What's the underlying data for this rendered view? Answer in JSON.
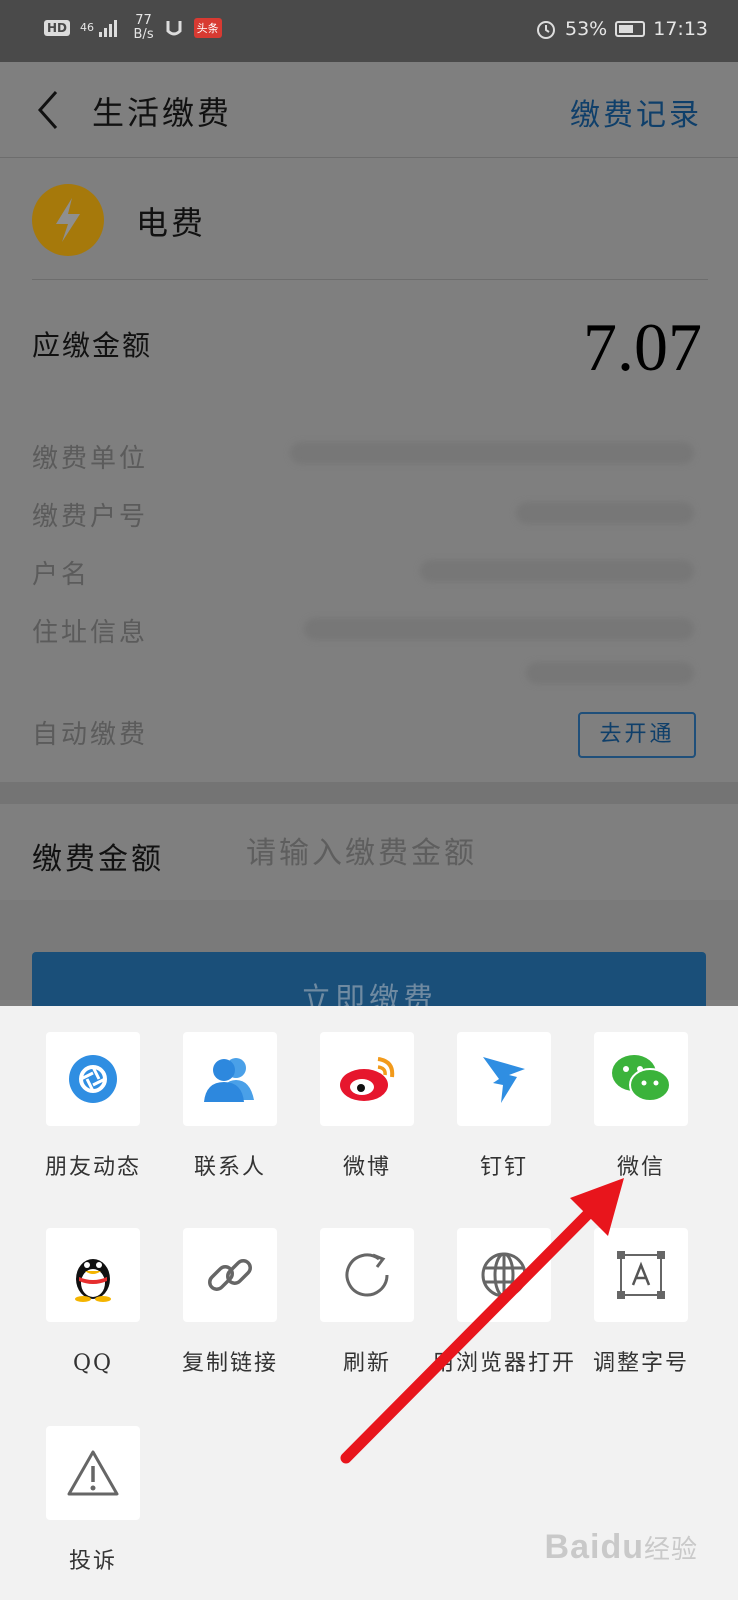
{
  "status_bar": {
    "hd": "HD",
    "network": "46",
    "speed_value": "77",
    "speed_unit": "B/s",
    "app_badge": "头条",
    "battery": "53%",
    "time": "17:13"
  },
  "nav": {
    "title": "生活缴费",
    "records_link": "缴费记录"
  },
  "bill": {
    "type": "电费",
    "due_label": "应缴金额",
    "due_amount": "7.07",
    "fields": [
      "缴费单位",
      "缴费户号",
      "户名",
      "住址信息",
      "自动缴费"
    ],
    "auto_pay_button": "去开通"
  },
  "payment": {
    "amount_label": "缴费金额",
    "amount_placeholder": "请输入缴费金额",
    "pay_button": "立即缴费"
  },
  "share_sheet": {
    "items": [
      {
        "label": "朋友动态",
        "icon": "friends-moments-icon"
      },
      {
        "label": "联系人",
        "icon": "contacts-icon"
      },
      {
        "label": "微博",
        "icon": "weibo-icon"
      },
      {
        "label": "钉钉",
        "icon": "dingtalk-icon"
      },
      {
        "label": "微信",
        "icon": "wechat-icon"
      },
      {
        "label": "QQ",
        "icon": "qq-icon"
      },
      {
        "label": "复制链接",
        "icon": "link-icon"
      },
      {
        "label": "刷新",
        "icon": "refresh-icon"
      },
      {
        "label": "用浏览器打开",
        "icon": "globe-icon"
      },
      {
        "label": "调整字号",
        "icon": "font-size-icon"
      },
      {
        "label": "投诉",
        "icon": "warning-icon"
      }
    ]
  },
  "watermark": {
    "brand": "Bai",
    "brand2": "du",
    "suffix": "经验"
  },
  "colors": {
    "accent_blue": "#1a4f79",
    "wechat_green": "#3bb33b",
    "arrow_red": "#e8151c"
  }
}
